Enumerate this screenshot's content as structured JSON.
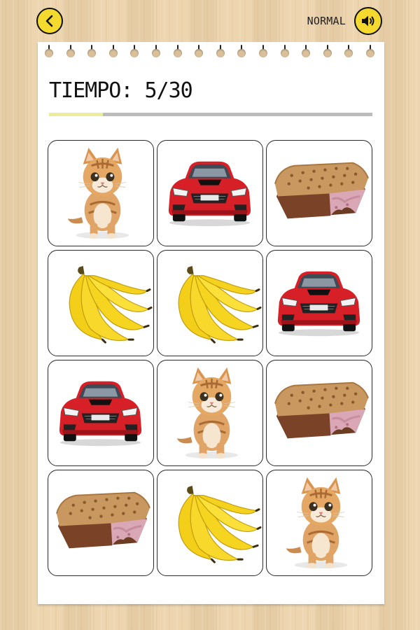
{
  "header": {
    "back_icon": "chevron-left-icon",
    "difficulty_label": "NORMAL",
    "sound_icon": "speaker-icon",
    "accent_color": "#f4da2e"
  },
  "game": {
    "timer_text": "TIEMPO: 5/30",
    "elapsed": 5,
    "total": 30,
    "progress_fraction": 0.1667,
    "rows": 4,
    "cols": 3,
    "cards": [
      {
        "image": "kitten"
      },
      {
        "image": "red-car"
      },
      {
        "image": "ice-cream-sandwich"
      },
      {
        "image": "banana"
      },
      {
        "image": "banana"
      },
      {
        "image": "red-car"
      },
      {
        "image": "red-car"
      },
      {
        "image": "kitten"
      },
      {
        "image": "ice-cream-sandwich"
      },
      {
        "image": "ice-cream-sandwich"
      },
      {
        "image": "banana"
      },
      {
        "image": "kitten"
      }
    ]
  }
}
